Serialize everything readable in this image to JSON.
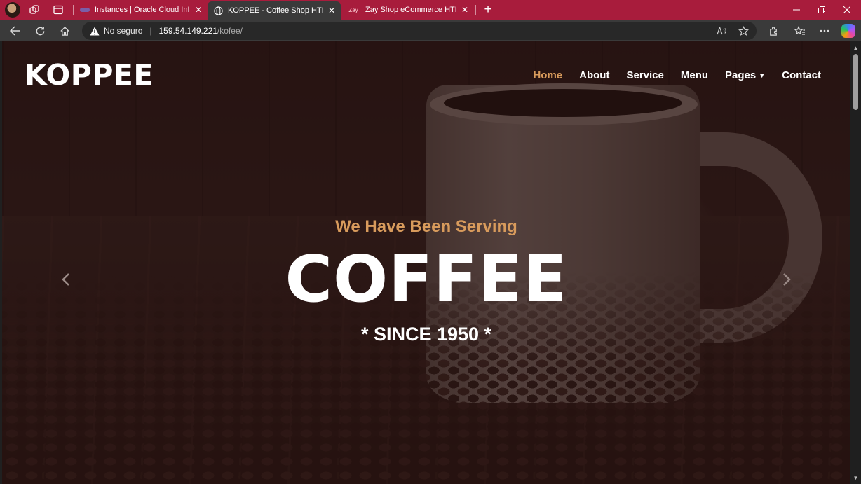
{
  "browser": {
    "tabs": [
      {
        "title": "Instances | Oracle Cloud Infrastructure",
        "favicon": "oracle-cloud-icon",
        "active": false
      },
      {
        "title": "KOPPEE - Coffee Shop HTML Template",
        "favicon": "globe-icon",
        "active": true
      },
      {
        "title": "Zay Shop eCommerce HTML CSS Template",
        "favicon_text": "Zay",
        "active": false
      }
    ],
    "new_tab_label": "+",
    "address": {
      "security_label": "No seguro",
      "host": "159.54.149.221",
      "path": "/kofee/"
    },
    "accent_color": "#a81c3c"
  },
  "site": {
    "brand": "KOPPEE",
    "nav": [
      {
        "label": "Home",
        "active": true
      },
      {
        "label": "About",
        "active": false
      },
      {
        "label": "Service",
        "active": false
      },
      {
        "label": "Menu",
        "active": false
      },
      {
        "label": "Pages",
        "active": false,
        "dropdown": true
      },
      {
        "label": "Contact",
        "active": false
      }
    ],
    "hero": {
      "kicker": "We Have Been Serving",
      "title": "COFFEE",
      "subtitle": "* SINCE 1950 *",
      "accent_color": "#d89b5c"
    }
  }
}
